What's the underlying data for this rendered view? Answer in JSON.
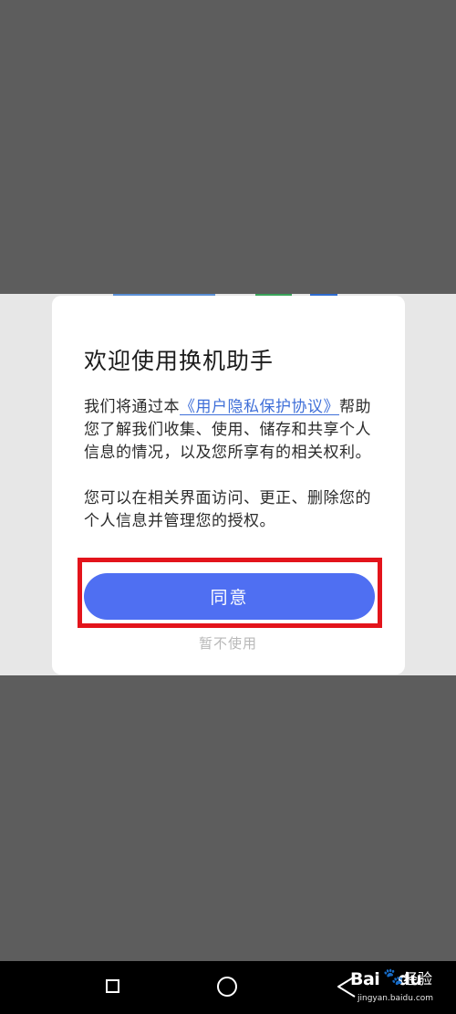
{
  "dialog": {
    "title": "欢迎使用换机助手",
    "body_prefix": "我们将通过本",
    "privacy_link": "《用户隐私保护协议》",
    "body_rest": "帮助您了解我们收集、使用、储存和共享个人信息的情况，以及您所享有的相关权利。",
    "body_para2": "您可以在相关界面访问、更正、删除您的个人信息并管理您的授权。",
    "agree_label": "同意",
    "decline_label": "暂不使用"
  },
  "colors": {
    "accent": "#4f6ff2",
    "link": "#3f6fd8",
    "highlight": "#e3141b",
    "overlay": "#5d5d5d"
  },
  "nav": {
    "recent_icon": "square-icon",
    "home_icon": "circle-icon",
    "back_icon": "triangle-back-icon"
  },
  "watermark": {
    "brand": "Bai",
    "brand_suffix": "du",
    "product": "经验",
    "url": "jingyan.baidu.com",
    "icon": "paw-icon"
  }
}
